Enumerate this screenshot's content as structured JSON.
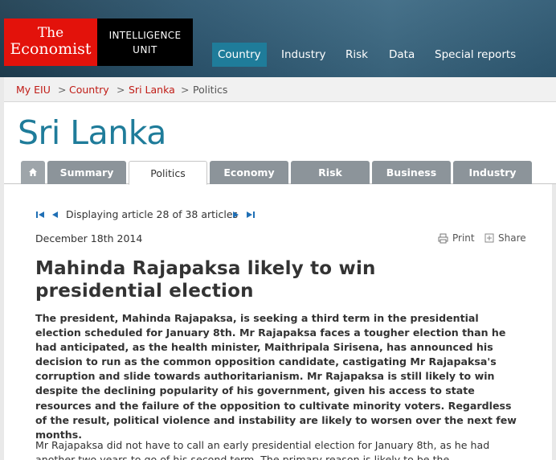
{
  "brand": {
    "economist_line1": "The",
    "economist_line2": "Economist",
    "eiu_line1": "INTELLIGENCE",
    "eiu_line2": "UNIT",
    "colors": {
      "red": "#e3120b",
      "black": "#000000",
      "accent": "#1f7c9a"
    }
  },
  "topnav": {
    "items": [
      {
        "label": "Country",
        "active": true
      },
      {
        "label": "Industry",
        "active": false
      },
      {
        "label": "Risk",
        "active": false
      },
      {
        "label": "Data",
        "active": false
      },
      {
        "label": "Special reports",
        "active": false
      }
    ]
  },
  "breadcrumb": {
    "items": [
      "My EIU",
      "Country",
      "Sri Lanka",
      "Politics"
    ],
    "separator": ">"
  },
  "page_title": "Sri Lanka",
  "tabs": {
    "home_icon": "home-icon",
    "items": [
      {
        "label": "Summary",
        "active": false
      },
      {
        "label": "Politics",
        "active": true
      },
      {
        "label": "Economy",
        "active": false
      },
      {
        "label": "Risk",
        "active": false
      },
      {
        "label": "Business",
        "active": false
      },
      {
        "label": "Industry",
        "active": false
      }
    ]
  },
  "pager": {
    "text": "Displaying article 28 of 38 articles",
    "icons": [
      "first-page-icon",
      "prev-page-icon",
      "next-page-icon",
      "last-page-icon"
    ]
  },
  "article": {
    "date": "December 18th 2014",
    "print_label": "Print",
    "share_label": "Share",
    "headline": "Mahinda Rajapaksa likely to win presidential election",
    "lead": "The president, Mahinda Rajapaksa, is seeking a third term in the presidential election scheduled for January 8th. Mr Rajapaksa faces a tougher election than he had anticipated, as the health minister, Maithripala Sirisena, has announced his decision to run as the common opposition candidate, castigating Mr Rajapaksa's corruption and slide towards authoritarianism. Mr Rajapaksa is still likely to win despite the declining popularity of his government, given his access to state resources and the failure of the opposition to cultivate minority voters. Regardless of the result, political violence and instability are likely to worsen over the next few months.",
    "body": "Mr Rajapaksa did not have to call an early presidential election for January 8th, as he had another two years to go of his second term. The primary reason is likely to be the"
  }
}
